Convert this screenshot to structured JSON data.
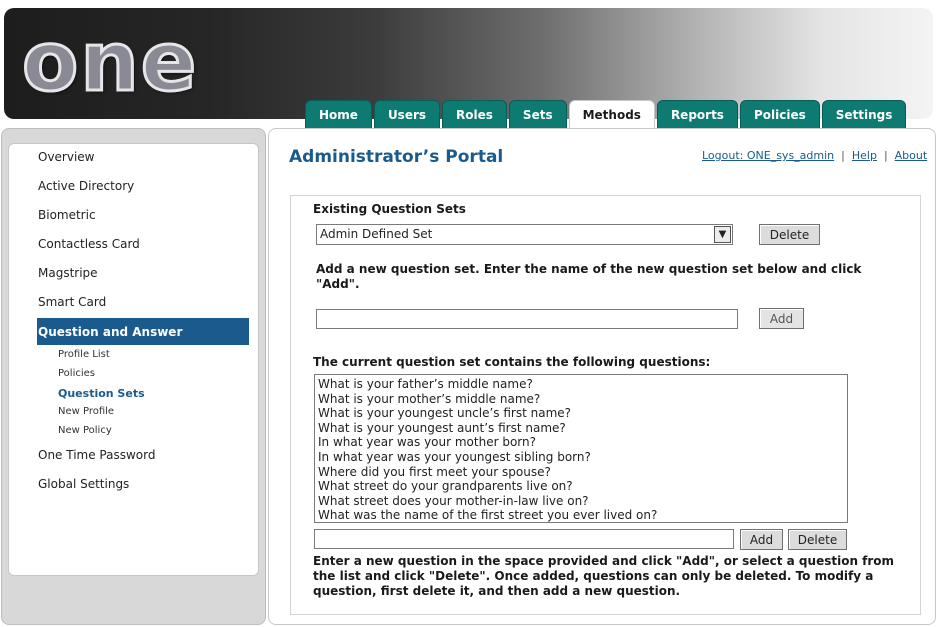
{
  "header": {
    "logo_text": "one",
    "tabs": [
      {
        "label": "Home"
      },
      {
        "label": "Users"
      },
      {
        "label": "Roles"
      },
      {
        "label": "Sets"
      },
      {
        "label": "Methods"
      },
      {
        "label": "Reports"
      },
      {
        "label": "Policies"
      },
      {
        "label": "Settings"
      }
    ],
    "active_tab": "Methods",
    "tab_color": "#0e7b73"
  },
  "sidebar": {
    "items": [
      {
        "label": "Overview"
      },
      {
        "label": "Active Directory"
      },
      {
        "label": "Biometric"
      },
      {
        "label": "Contactless Card"
      },
      {
        "label": "Magstripe"
      },
      {
        "label": "Smart Card"
      },
      {
        "label": "Question and Answer"
      },
      {
        "label": "One Time Password"
      },
      {
        "label": "Global Settings"
      }
    ],
    "active_item": "Question and Answer",
    "subitems": [
      {
        "label": "Profile List"
      },
      {
        "label": "Policies"
      },
      {
        "label": "Question Sets"
      },
      {
        "label": "New Profile"
      },
      {
        "label": "New Policy"
      }
    ],
    "current_subitem": "Question Sets",
    "active_color": "#1b5a8c"
  },
  "main": {
    "title": "Administrator’s Portal",
    "links": {
      "logout": "Logout: ONE_sys_admin",
      "help": "Help",
      "about": "About",
      "separator": "|"
    },
    "existing_sets": {
      "label": "Existing Question Sets",
      "selected": "Admin Defined Set",
      "delete_button": "Delete"
    },
    "add_set": {
      "instruction": "Add a new question set. Enter the name of the new question set below and click \"Add\".",
      "input_value": "",
      "add_button": "Add"
    },
    "questions": {
      "label": "The current question set contains the following questions:",
      "items": [
        "What is your father’s middle name?",
        "What is your mother’s middle name?",
        "What is your youngest uncle’s first name?",
        "What is your youngest aunt’s first name?",
        "In what year was your mother born?",
        "In what year was your youngest sibling born?",
        "Where did you first meet your spouse?",
        "What street do your grandparents live on?",
        "What street does your mother-in-law live on?",
        "What was the name of the first street you ever lived on?"
      ],
      "new_question_value": "",
      "add_button": "Add",
      "delete_button": "Delete",
      "help_text": "Enter a new question in the space provided and click \"Add\", or select a question from the list and click \"Delete\". Once added, questions can only be deleted. To modify a question, first delete it, and then add a new question."
    }
  }
}
